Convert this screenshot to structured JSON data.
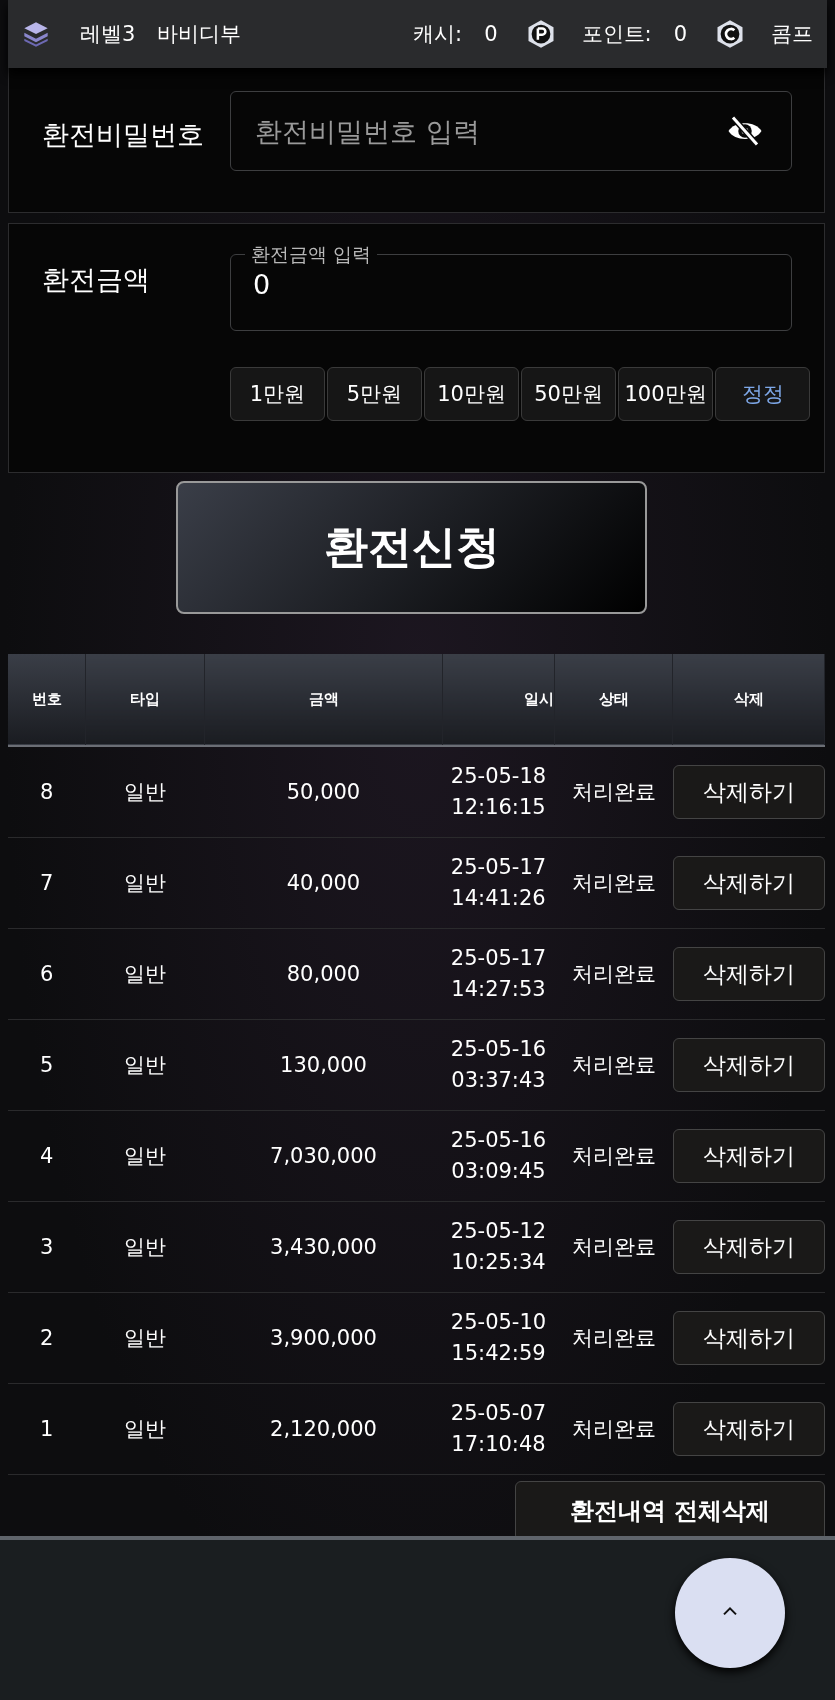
{
  "header": {
    "level": "레벨3",
    "nickname": "바비디부",
    "cash_label": "캐시:",
    "cash": "0",
    "point_label": "포인트:",
    "points": "0",
    "comp": "콤프"
  },
  "password": {
    "label": "환전비밀번호",
    "placeholder": "환전비밀번호 입력"
  },
  "amount": {
    "label": "환전금액",
    "field_label": "환전금액 입력",
    "value": "0"
  },
  "quick_buttons": [
    {
      "label": "1만원",
      "kind": "add"
    },
    {
      "label": "5만원",
      "kind": "add"
    },
    {
      "label": "10만원",
      "kind": "add"
    },
    {
      "label": "50만원",
      "kind": "add"
    },
    {
      "label": "100만원",
      "kind": "add"
    },
    {
      "label": "정정",
      "kind": "reset"
    }
  ],
  "submit": "환전신청",
  "table": {
    "columns": [
      "번호",
      "타입",
      "금액",
      "일시",
      "상태",
      "삭제"
    ],
    "rows": [
      {
        "no": "8",
        "type": "일반",
        "amount": "50,000",
        "date": "25-05-18",
        "time": "12:16:15",
        "status": "처리완료",
        "action": "삭제하기"
      },
      {
        "no": "7",
        "type": "일반",
        "amount": "40,000",
        "date": "25-05-17",
        "time": "14:41:26",
        "status": "처리완료",
        "action": "삭제하기"
      },
      {
        "no": "6",
        "type": "일반",
        "amount": "80,000",
        "date": "25-05-17",
        "time": "14:27:53",
        "status": "처리완료",
        "action": "삭제하기"
      },
      {
        "no": "5",
        "type": "일반",
        "amount": "130,000",
        "date": "25-05-16",
        "time": "03:37:43",
        "status": "처리완료",
        "action": "삭제하기"
      },
      {
        "no": "4",
        "type": "일반",
        "amount": "7,030,000",
        "date": "25-05-16",
        "time": "03:09:45",
        "status": "처리완료",
        "action": "삭제하기"
      },
      {
        "no": "3",
        "type": "일반",
        "amount": "3,430,000",
        "date": "25-05-12",
        "time": "10:25:34",
        "status": "처리완료",
        "action": "삭제하기"
      },
      {
        "no": "2",
        "type": "일반",
        "amount": "3,900,000",
        "date": "25-05-10",
        "time": "15:42:59",
        "status": "처리완료",
        "action": "삭제하기"
      },
      {
        "no": "1",
        "type": "일반",
        "amount": "2,120,000",
        "date": "25-05-07",
        "time": "17:10:48",
        "status": "처리완료",
        "action": "삭제하기"
      }
    ]
  },
  "delete_all": "환전내역 전체삭제"
}
